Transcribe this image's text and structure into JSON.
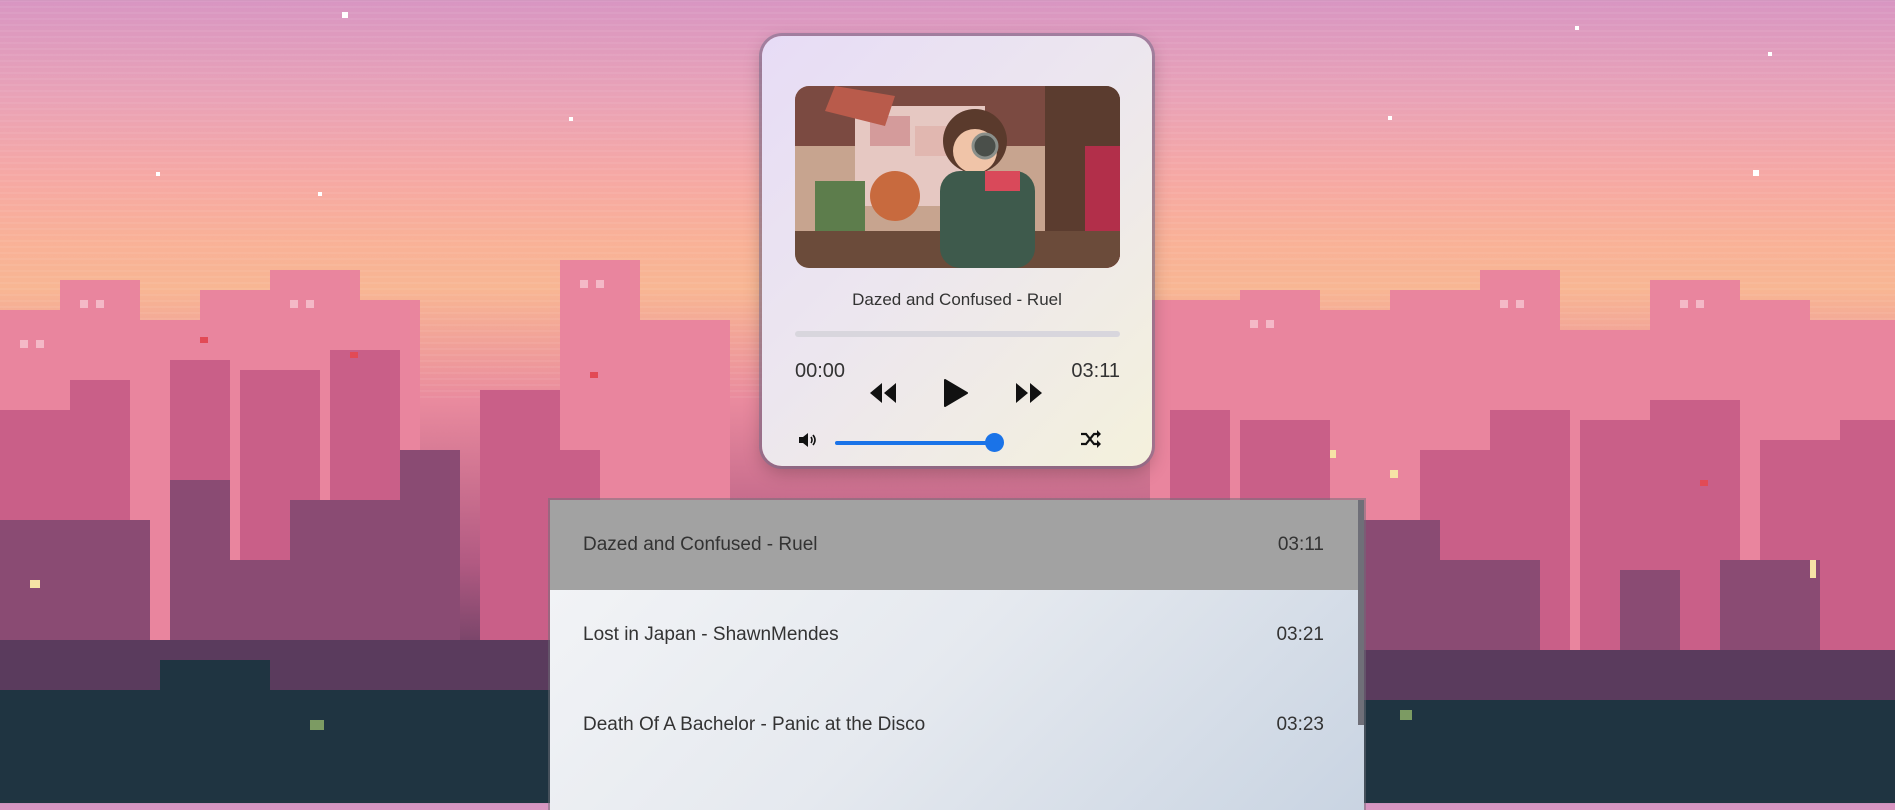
{
  "player": {
    "now_playing": "Dazed and Confused - Ruel",
    "current_time": "00:00",
    "duration": "03:11",
    "progress": 0,
    "volume": 0.9,
    "controls": {
      "previous_icon": "rewind-icon",
      "play_icon": "play-icon",
      "next_icon": "fast-forward-icon",
      "volume_icon": "speaker-icon",
      "shuffle_icon": "shuffle-icon"
    },
    "cover_art": "lofi girl studying with headphones"
  },
  "playlist": {
    "items": [
      {
        "title": "Dazed and Confused - Ruel",
        "duration": "03:11",
        "active": true
      },
      {
        "title": "Lost in Japan - ShawnMendes",
        "duration": "03:21",
        "active": false
      },
      {
        "title": "Death Of A Bachelor - Panic at the Disco",
        "duration": "03:23",
        "active": false
      }
    ]
  },
  "colors": {
    "accent": "#1a73e8",
    "active_row": "#a2a2a2"
  }
}
